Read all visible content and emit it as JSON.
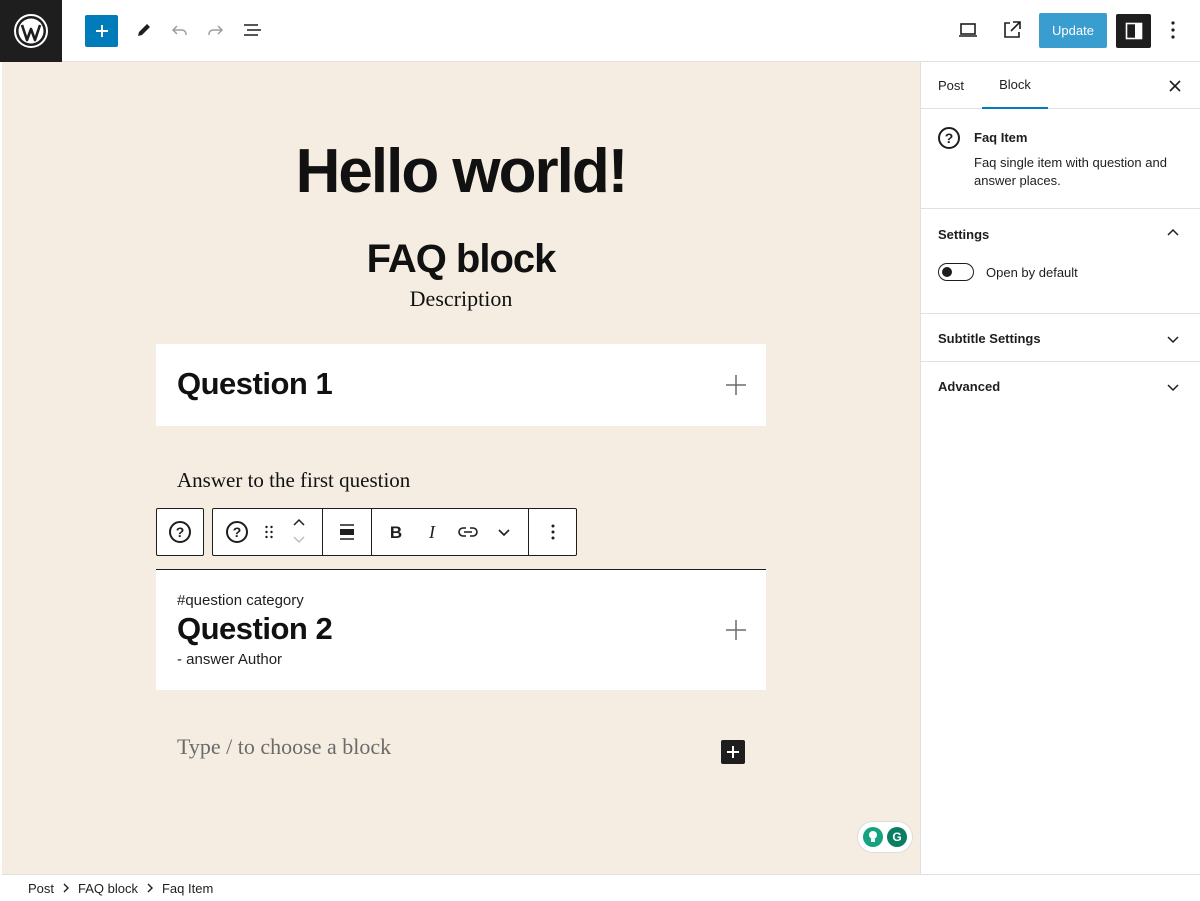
{
  "toolbar": {
    "update_label": "Update",
    "icons": [
      "wordpress-logo",
      "plus-icon",
      "pencil-icon",
      "undo-icon",
      "redo-icon",
      "list-view-icon",
      "desktop-preview-icon",
      "external-link-icon",
      "sidebar-icon",
      "more-vertical-icon"
    ],
    "accent_color": "#007cba"
  },
  "canvas": {
    "background": "#f5ede2",
    "post_title": "Hello world!",
    "faq_title": "FAQ block",
    "faq_description": "Description",
    "questions": [
      {
        "question": "Question 1",
        "category": "",
        "author": ""
      },
      {
        "question": "Question 2",
        "category": "#question category",
        "author": "- answer Author"
      }
    ],
    "answer": "Answer to the first question",
    "placeholder": "Type / to choose a block"
  },
  "block_toolbar": {
    "icons": [
      "faq-parent-icon",
      "faq-item-icon",
      "drag-handle-icon",
      "move-up-icon",
      "move-down-icon",
      "align-icon",
      "bold-icon",
      "italic-icon",
      "link-icon",
      "more-options-chevron-icon",
      "options-icon"
    ]
  },
  "sidebar": {
    "tabs": [
      {
        "label": "Post"
      },
      {
        "label": "Block",
        "active": true
      }
    ],
    "block_name": "Faq Item",
    "block_description": "Faq single item with question and answer places.",
    "panels": [
      {
        "title": "Settings",
        "expanded": true,
        "toggle_label": "Open by default",
        "toggle_on": false
      },
      {
        "title": "Subtitle Settings",
        "expanded": false
      },
      {
        "title": "Advanced",
        "expanded": false
      }
    ]
  },
  "breadcrumb": [
    "Post",
    "FAQ block",
    "Faq Item"
  ]
}
